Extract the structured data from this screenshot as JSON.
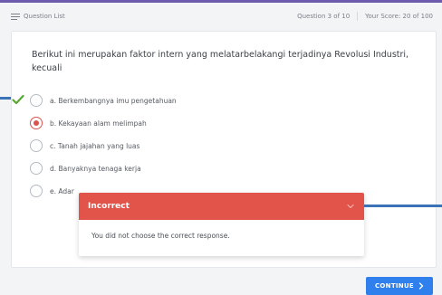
{
  "header": {
    "question_list_label": "Question List",
    "question_position": "Question 3 of 10",
    "score": "Your Score: 20 of 100"
  },
  "question": {
    "prompt": "Berikut ini merupakan faktor intern yang melatarbelakangi terjadinya Revolusi Industri, kecuali"
  },
  "options": [
    {
      "label": "a. Berkembangnya imu pengetahuan",
      "state": "correct"
    },
    {
      "label": "b. Kekayaan alam melimpah",
      "state": "selected"
    },
    {
      "label": "c. Tanah jajahan yang luas",
      "state": "unselected"
    },
    {
      "label": "d. Banyaknya tenaga kerja",
      "state": "unselected"
    },
    {
      "label": "e. Adar",
      "state": "unselected"
    }
  ],
  "feedback": {
    "title": "Incorrect",
    "message": "You did not choose the correct response.",
    "icon": "chevron-down-icon"
  },
  "continue_button": {
    "label": "CONTINUE"
  },
  "colors": {
    "brand_bar": "#6d5cae",
    "incorrect": "#e2534a",
    "selected": "#d9534f",
    "correct_check": "#5aa832",
    "button": "#2f80ed",
    "pointer": "#3a73b8"
  }
}
